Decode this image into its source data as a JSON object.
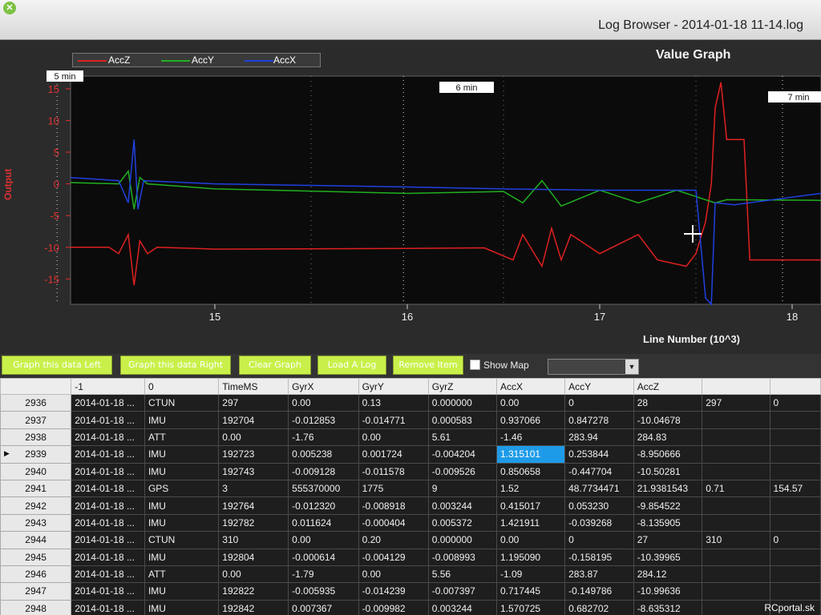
{
  "window": {
    "title": "Log Browser - 2014-01-18 11-14.log"
  },
  "graph": {
    "title": "Value Graph",
    "legend": [
      {
        "name": "AccZ",
        "color": "#e02020"
      },
      {
        "name": "AccY",
        "color": "#20b020"
      },
      {
        "name": "AccX",
        "color": "#2040e0"
      }
    ],
    "time_markers": [
      "5 min",
      "6 min",
      "7 min"
    ],
    "cursor_icon": "crosshair-icon"
  },
  "chart_data": {
    "type": "line",
    "ylabel": "Output",
    "xlabel": "Line Number (10^3)",
    "ylim": [
      -19,
      17
    ],
    "xlim": [
      14.25,
      18.15
    ],
    "yticks": [
      15,
      10,
      5,
      0,
      -5,
      -10,
      -15
    ],
    "xticks": [
      15,
      16,
      17,
      18
    ],
    "series": [
      {
        "name": "AccZ",
        "color": "#e02020",
        "points": [
          [
            14.25,
            -10
          ],
          [
            14.45,
            -10
          ],
          [
            14.5,
            -11
          ],
          [
            14.55,
            -8
          ],
          [
            14.58,
            -16
          ],
          [
            14.61,
            -9
          ],
          [
            14.65,
            -11
          ],
          [
            14.7,
            -10
          ],
          [
            15,
            -10.3
          ],
          [
            16,
            -10.2
          ],
          [
            16.4,
            -10.1
          ],
          [
            16.55,
            -12
          ],
          [
            16.6,
            -8
          ],
          [
            16.7,
            -13
          ],
          [
            16.75,
            -7
          ],
          [
            16.8,
            -12
          ],
          [
            16.85,
            -8
          ],
          [
            17,
            -11
          ],
          [
            17.2,
            -8
          ],
          [
            17.3,
            -12
          ],
          [
            17.45,
            -13
          ],
          [
            17.5,
            -11
          ],
          [
            17.55,
            -6
          ],
          [
            17.58,
            0
          ],
          [
            17.6,
            12
          ],
          [
            17.63,
            16
          ],
          [
            17.66,
            7
          ],
          [
            17.75,
            7
          ],
          [
            17.78,
            -12
          ],
          [
            18.15,
            -12
          ]
        ]
      },
      {
        "name": "AccY",
        "color": "#20b020",
        "points": [
          [
            14.25,
            0.2
          ],
          [
            14.5,
            0
          ],
          [
            14.55,
            2
          ],
          [
            14.58,
            -4
          ],
          [
            14.61,
            1
          ],
          [
            14.65,
            0
          ],
          [
            15,
            -0.8
          ],
          [
            16,
            -1.5
          ],
          [
            16.5,
            -1.2
          ],
          [
            16.6,
            -3
          ],
          [
            16.7,
            0.5
          ],
          [
            16.8,
            -3.5
          ],
          [
            17,
            -1
          ],
          [
            17.2,
            -3
          ],
          [
            17.4,
            -1
          ],
          [
            17.55,
            -2.5
          ],
          [
            17.6,
            -3
          ],
          [
            17.66,
            -2.5
          ],
          [
            18.15,
            -2.6
          ]
        ]
      },
      {
        "name": "AccX",
        "color": "#2040e0",
        "points": [
          [
            14.25,
            1
          ],
          [
            14.5,
            0.5
          ],
          [
            14.55,
            -3
          ],
          [
            14.58,
            7
          ],
          [
            14.6,
            -4
          ],
          [
            14.63,
            0.5
          ],
          [
            15,
            0
          ],
          [
            16,
            -0.5
          ],
          [
            16.5,
            -0.8
          ],
          [
            17,
            -1
          ],
          [
            17.5,
            -1
          ],
          [
            17.55,
            -18
          ],
          [
            17.58,
            -20
          ],
          [
            17.6,
            -3
          ],
          [
            17.7,
            -3.3
          ],
          [
            18.15,
            -1.5
          ]
        ]
      }
    ]
  },
  "toolbar": {
    "buttons": [
      "Graph this data Left",
      "Graph this data Right",
      "Clear Graph",
      "Load A Log",
      "Remove Item"
    ],
    "show_map_label": "Show Map",
    "combo_value": ""
  },
  "table": {
    "headers": [
      "",
      "-1",
      "0",
      "TimeMS",
      "GyrX",
      "GyrY",
      "GyrZ",
      "AccX",
      "AccY",
      "AccZ",
      "",
      ""
    ],
    "rows": [
      [
        "2936",
        "2014-01-18 ...",
        "CTUN",
        "297",
        "0.00",
        "0.13",
        "0.000000",
        "0.00",
        "0",
        "28",
        "297",
        "0"
      ],
      [
        "2937",
        "2014-01-18 ...",
        "IMU",
        "192704",
        "-0.012853",
        "-0.014771",
        "0.000583",
        "0.937066",
        "0.847278",
        "-10.04678",
        "",
        ""
      ],
      [
        "2938",
        "2014-01-18 ...",
        "ATT",
        "0.00",
        "-1.76",
        "0.00",
        "5.61",
        "-1.46",
        "283.94",
        "284.83",
        "",
        ""
      ],
      [
        "2939",
        "2014-01-18 ...",
        "IMU",
        "192723",
        "0.005238",
        "0.001724",
        "-0.004204",
        "1.315101",
        "0.253844",
        "-8.950666",
        "",
        ""
      ],
      [
        "2940",
        "2014-01-18 ...",
        "IMU",
        "192743",
        "-0.009128",
        "-0.011578",
        "-0.009526",
        "0.850658",
        "-0.447704",
        "-10.50281",
        "",
        ""
      ],
      [
        "2941",
        "2014-01-18 ...",
        "GPS",
        "3",
        "555370000",
        "1775",
        "9",
        "1.52",
        "48.7734471",
        "21.9381543",
        "0.71",
        "154.57"
      ],
      [
        "2942",
        "2014-01-18 ...",
        "IMU",
        "192764",
        "-0.012320",
        "-0.008918",
        "0.003244",
        "0.415017",
        "0.053230",
        "-9.854522",
        "",
        ""
      ],
      [
        "2943",
        "2014-01-18 ...",
        "IMU",
        "192782",
        "0.011624",
        "-0.000404",
        "0.005372",
        "1.421911",
        "-0.039268",
        "-8.135905",
        "",
        ""
      ],
      [
        "2944",
        "2014-01-18 ...",
        "CTUN",
        "310",
        "0.00",
        "0.20",
        "0.000000",
        "0.00",
        "0",
        "27",
        "310",
        "0"
      ],
      [
        "2945",
        "2014-01-18 ...",
        "IMU",
        "192804",
        "-0.000614",
        "-0.004129",
        "-0.008993",
        "1.195090",
        "-0.158195",
        "-10.39965",
        "",
        ""
      ],
      [
        "2946",
        "2014-01-18 ...",
        "ATT",
        "0.00",
        "-1.79",
        "0.00",
        "5.56",
        "-1.09",
        "283.87",
        "284.12",
        "",
        ""
      ],
      [
        "2947",
        "2014-01-18 ...",
        "IMU",
        "192822",
        "-0.005935",
        "-0.014239",
        "-0.007397",
        "0.717445",
        "-0.149786",
        "-10.99636",
        "",
        ""
      ],
      [
        "2948",
        "2014-01-18 ...",
        "IMU",
        "192842",
        "0.007367",
        "-0.009982",
        "0.003244",
        "1.570725",
        "0.682702",
        "-8.635312",
        "",
        ""
      ]
    ],
    "selected_row": 3,
    "selected_col": 7,
    "pointer_row": 3
  },
  "watermark": "RCportal.sk"
}
